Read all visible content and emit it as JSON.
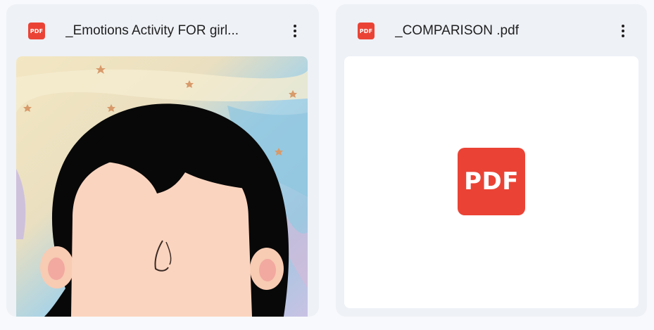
{
  "files": [
    {
      "name": "_Emotions Activity FOR girl...",
      "type_badge": "PDF",
      "preview_kind": "image",
      "preview_description": ""
    },
    {
      "name": "_COMPARISON .pdf",
      "type_badge": "PDF",
      "preview_kind": "generic-pdf-icon",
      "preview_icon_label": "PDF"
    }
  ],
  "icons": {
    "file_type": "pdf-icon",
    "menu": "more-vert-icon"
  },
  "colors": {
    "pdf_red": "#ea4335",
    "card_bg": "#eef1f6",
    "page_bg": "#f8f9fc",
    "text": "#1f1f1f"
  }
}
